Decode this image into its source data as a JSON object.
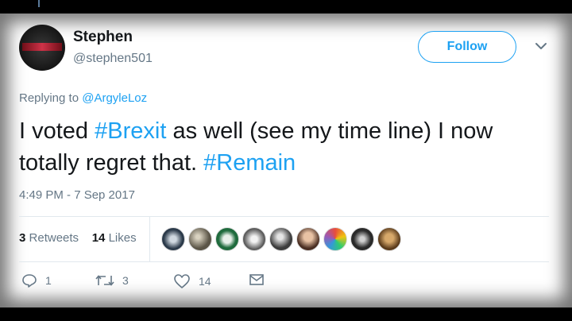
{
  "user": {
    "name": "Stephen",
    "handle": "@stephen501"
  },
  "follow_label": "Follow",
  "reply_prefix": "Replying to ",
  "reply_to": "@ArgyleLoz",
  "tweet": {
    "part1": "I voted ",
    "tag1": "#Brexit",
    "part2": " as well (see my time line) I now totally regret that. ",
    "tag2": "#Remain"
  },
  "timestamp": "4:49 PM - 7 Sep 2017",
  "stats": {
    "retweets_count": "3",
    "retweets_label": "Retweets",
    "likes_count": "14",
    "likes_label": "Likes"
  },
  "actions": {
    "reply_count": "1",
    "retweet_count": "3",
    "like_count": "14"
  },
  "icons": {
    "dropdown": "chevron-down-icon",
    "reply": "reply-icon",
    "retweet": "retweet-icon",
    "like": "heart-icon",
    "message": "envelope-icon"
  },
  "colors": {
    "accent": "#1da1f2",
    "muted": "#657786",
    "text": "#14171a"
  }
}
